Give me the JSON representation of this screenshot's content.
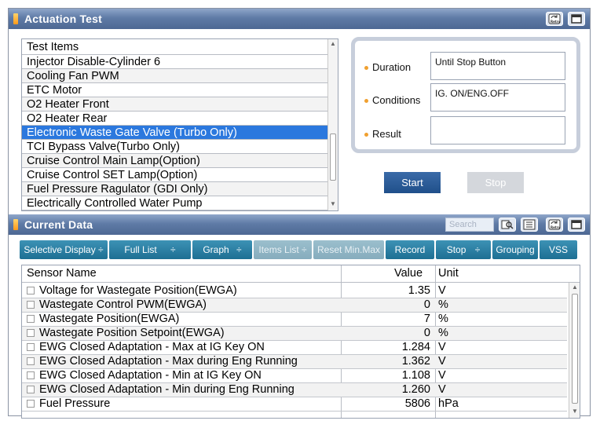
{
  "actuation": {
    "title": "Actuation Test",
    "list_header": "Test Items",
    "items": [
      "Injector Disable-Cylinder 6",
      "Cooling Fan PWM",
      "ETC Motor",
      "O2 Heater Front",
      "O2 Heater Rear",
      "Electronic Waste Gate Valve (Turbo Only)",
      "TCI Bypass Valve(Turbo Only)",
      "Cruise Control Main Lamp(Option)",
      "Cruise Control SET Lamp(Option)",
      "Fuel Pressure Ragulator (GDI Only)",
      "Electrically Controlled Water Pump"
    ],
    "selected_item": "Electronic Waste Gate Valve (Turbo Only)",
    "duration_label": "Duration",
    "duration_value": "Until Stop Button",
    "conditions_label": "Conditions",
    "conditions_value": "IG. ON/ENG.OFF",
    "result_label": "Result",
    "result_value": "",
    "start_label": "Start",
    "stop_label": "Stop"
  },
  "current_data": {
    "title": "Current Data",
    "search_placeholder": "Search",
    "toolbar": {
      "selective_display": "Selective Display ÷",
      "full_list": "Full List",
      "full_list_arrow": "÷",
      "graph": "Graph",
      "graph_arrow": "÷",
      "items_list": "Items List ÷",
      "reset_minmax": "Reset Min.Max",
      "record": "Record",
      "stop": "Stop",
      "stop_arrow": "÷",
      "grouping": "Grouping",
      "vss": "VSS"
    },
    "columns": {
      "name": "Sensor Name",
      "value": "Value",
      "unit": "Unit"
    },
    "rows": [
      {
        "name": "Voltage for Wastegate Position(EWGA)",
        "value": "1.35",
        "unit": "V"
      },
      {
        "name": "Wastegate Control PWM(EWGA)",
        "value": "0",
        "unit": "%"
      },
      {
        "name": "Wastegate Position(EWGA)",
        "value": "7",
        "unit": "%"
      },
      {
        "name": "Wastegate Position Setpoint(EWGA)",
        "value": "0",
        "unit": "%"
      },
      {
        "name": "EWG Closed Adaptation - Max at IG Key ON",
        "value": "1.284",
        "unit": "V"
      },
      {
        "name": "EWG Closed Adaptation - Max during Eng Running",
        "value": "1.362",
        "unit": "V"
      },
      {
        "name": "EWG Closed Adaptation - Min at IG Key ON",
        "value": "1.108",
        "unit": "V"
      },
      {
        "name": "EWG Closed Adaptation - Min during Eng Running",
        "value": "1.260",
        "unit": "V"
      },
      {
        "name": "Fuel Pressure",
        "value": "5806",
        "unit": "hPa"
      }
    ]
  },
  "colors": {
    "title_bar": "#5f7ba6",
    "selected_row": "#2b78de",
    "start_button": "#2a5b96",
    "toolbar_button": "#2a82a6",
    "bullet": "#f0a030"
  },
  "icons": [
    "retry-icon",
    "window-icon",
    "find-icon",
    "list-icon"
  ]
}
